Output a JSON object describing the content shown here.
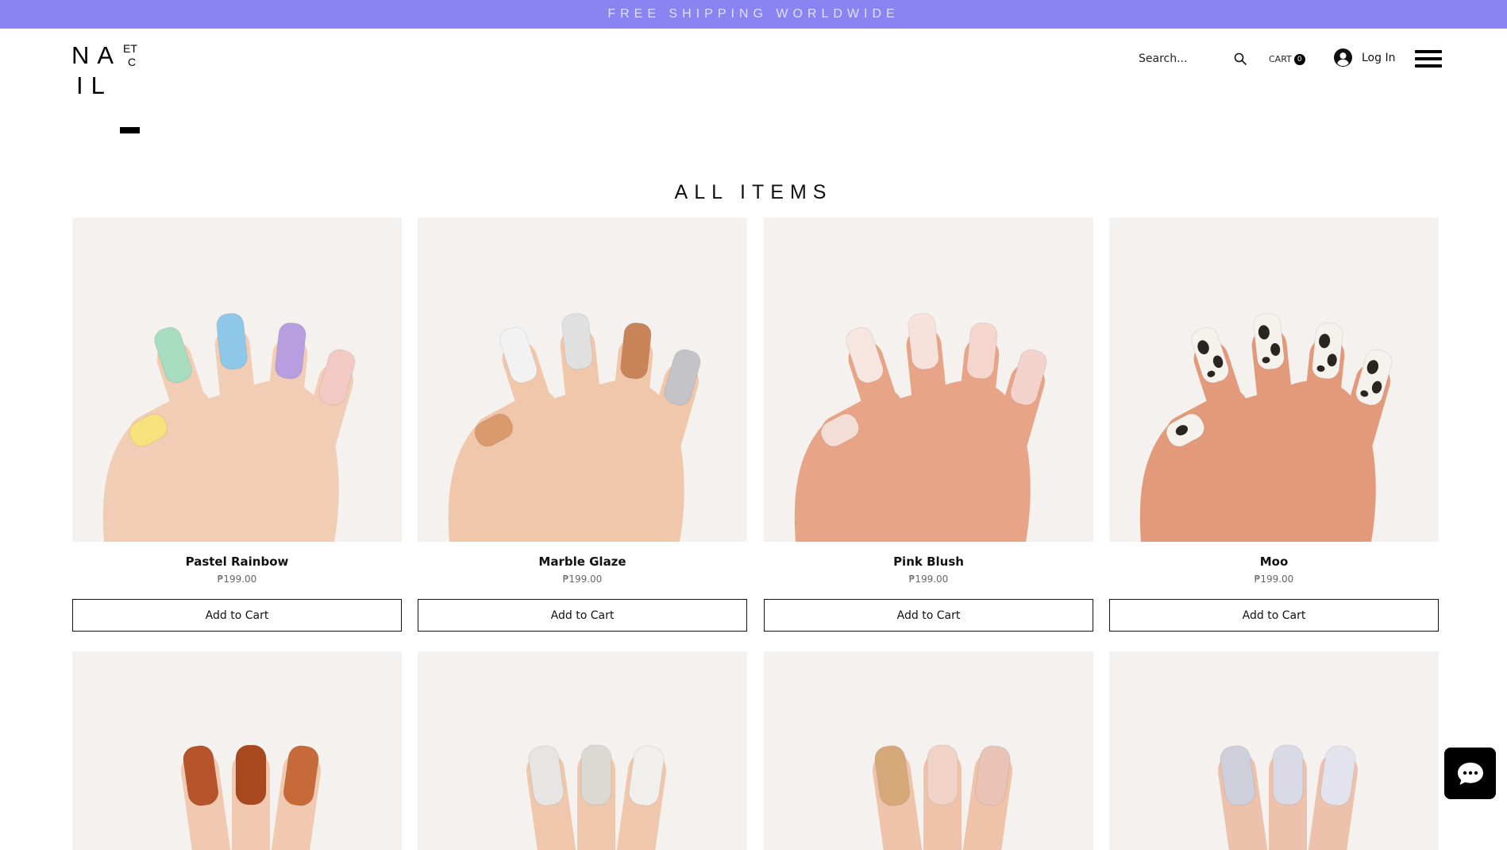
{
  "banner": {
    "text": "FREE SHIPPING WORLDWIDE"
  },
  "logo": {
    "line1": "NA",
    "line2": "IL",
    "small1": "ET",
    "small2": "C"
  },
  "header": {
    "search_placeholder": "Search...",
    "cart_label": "CART",
    "cart_count": "0",
    "login_label": "Log In"
  },
  "page": {
    "title": "ALL ITEMS"
  },
  "products": [
    {
      "name": "Pastel Rainbow",
      "price": "₱199.00",
      "button": "Add to Cart",
      "nail_colors": [
        "#f6e27d",
        "#a8dcc0",
        "#8fc7e8",
        "#b79ee0",
        "#f3c9c4"
      ]
    },
    {
      "name": "Marble Glaze",
      "price": "₱199.00",
      "button": "Add to Cart",
      "nail_colors": [
        "#d99b6d",
        "#f2f2f2",
        "#e0e0e0",
        "#c98559",
        "#c4c4c8"
      ]
    },
    {
      "name": "Pink Blush",
      "price": "₱199.00",
      "button": "Add to Cart",
      "nail_colors": [
        "#f4ddd4",
        "#f6e6df",
        "#f7e2db",
        "#f4d6cd",
        "#f2d2ca"
      ]
    },
    {
      "name": "Moo",
      "price": "₱199.00",
      "button": "Add to Cart",
      "nail_colors": [
        "#f5f1ec",
        "#f5f1ec",
        "#f5f1ec",
        "#f5f1ec",
        "#f5f1ec"
      ]
    }
  ],
  "products_row2": [
    {
      "nail_colors": [
        "#b5532a",
        "#a7481f",
        "#c76a3a"
      ]
    },
    {
      "nail_colors": [
        "#e7e5e3",
        "#dcd8d3",
        "#f1efec"
      ]
    },
    {
      "nail_colors": [
        "#d7a97a",
        "#f0d2c6",
        "#e9c3b5"
      ]
    },
    {
      "nail_colors": [
        "#cfcfdc",
        "#d9d9e6",
        "#e3e3ee"
      ]
    }
  ]
}
